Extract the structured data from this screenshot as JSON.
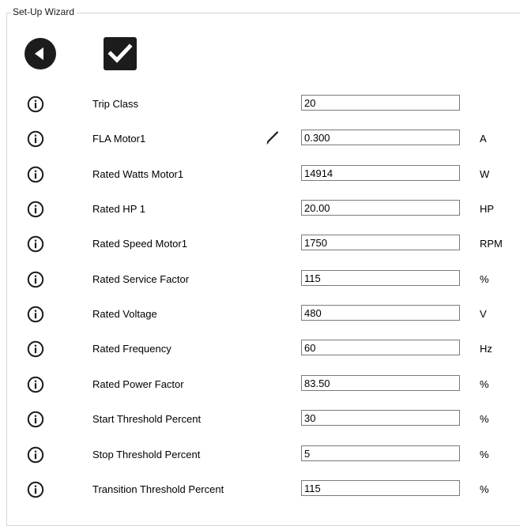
{
  "wizard": {
    "title": "Set-Up Wizard"
  },
  "nav": {
    "back_icon": "back-arrow-icon",
    "finish_icon": "checkmark-icon"
  },
  "parameters": [
    {
      "label": "Trip Class",
      "value": "20",
      "unit": "",
      "editing": false
    },
    {
      "label": "FLA Motor1",
      "value": "0.300",
      "unit": "A",
      "editing": true
    },
    {
      "label": "Rated Watts Motor1",
      "value": "14914",
      "unit": "W",
      "editing": false
    },
    {
      "label": "Rated HP 1",
      "value": "20.00",
      "unit": "HP",
      "editing": false
    },
    {
      "label": "Rated Speed Motor1",
      "value": "1750",
      "unit": "RPM",
      "editing": false
    },
    {
      "label": "Rated Service Factor",
      "value": "115",
      "unit": "%",
      "editing": false
    },
    {
      "label": "Rated Voltage",
      "value": "480",
      "unit": "V",
      "editing": false
    },
    {
      "label": "Rated Frequency",
      "value": "60",
      "unit": "Hz",
      "editing": false
    },
    {
      "label": "Rated Power Factor",
      "value": "83.50",
      "unit": "%",
      "editing": false
    },
    {
      "label": "Start Threshold Percent",
      "value": "30",
      "unit": "%",
      "editing": false
    },
    {
      "label": "Stop Threshold Percent",
      "value": "5",
      "unit": "%",
      "editing": false
    },
    {
      "label": "Transition Threshold Percent",
      "value": "115",
      "unit": "%",
      "editing": false
    }
  ],
  "colors": {
    "icon": "#1c1c1c",
    "frame_border": "#d5d5d5",
    "input_border": "#7a7a7a"
  }
}
